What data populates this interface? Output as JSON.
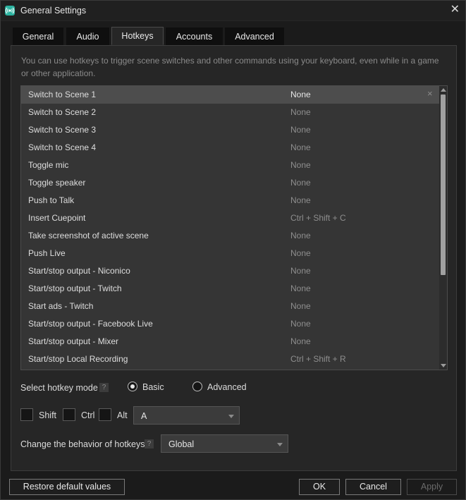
{
  "window": {
    "title": "General Settings"
  },
  "tabs": [
    {
      "label": "General"
    },
    {
      "label": "Audio"
    },
    {
      "label": "Hotkeys"
    },
    {
      "label": "Accounts"
    },
    {
      "label": "Advanced"
    }
  ],
  "active_tab": "Hotkeys",
  "description": "You can use hotkeys to trigger scene switches and other commands using your keyboard, even while in a game or other application.",
  "hotkeys": [
    {
      "command": "Switch to Scene 1",
      "key": "None"
    },
    {
      "command": "Switch to Scene 2",
      "key": "None"
    },
    {
      "command": "Switch to Scene 3",
      "key": "None"
    },
    {
      "command": "Switch to Scene 4",
      "key": "None"
    },
    {
      "command": "Toggle mic",
      "key": "None"
    },
    {
      "command": "Toggle speaker",
      "key": "None"
    },
    {
      "command": "Push to Talk",
      "key": "None"
    },
    {
      "command": "Insert Cuepoint",
      "key": "Ctrl + Shift + C"
    },
    {
      "command": "Take screenshot of active scene",
      "key": "None"
    },
    {
      "command": "Push Live",
      "key": "None"
    },
    {
      "command": "Start/stop output - Niconico",
      "key": "None"
    },
    {
      "command": "Start/stop output - Twitch",
      "key": "None"
    },
    {
      "command": "Start ads - Twitch",
      "key": "None"
    },
    {
      "command": "Start/stop output - Facebook Live",
      "key": "None"
    },
    {
      "command": "Start/stop output - Mixer",
      "key": "None"
    },
    {
      "command": "Start/stop Local Recording",
      "key": "Ctrl + Shift + R"
    }
  ],
  "selected_row": 0,
  "row_clear_glyph": "×",
  "hotkey_mode": {
    "label": "Select hotkey mode",
    "help": "?",
    "options": [
      "Basic",
      "Advanced"
    ],
    "selected": "Basic"
  },
  "modifiers": {
    "shift": {
      "label": "Shift",
      "checked": false
    },
    "ctrl": {
      "label": "Ctrl",
      "checked": false
    },
    "alt": {
      "label": "Alt",
      "checked": false
    },
    "key_value": "A"
  },
  "behavior": {
    "label": "Change the behavior of hotkeys",
    "help": "?",
    "value": "Global"
  },
  "buttons": {
    "restore": "Restore default values",
    "ok": "OK",
    "cancel": "Cancel",
    "apply": "Apply"
  },
  "colors": {
    "app_icon": "#2bb3a0",
    "selected_row": "#4d4d4d",
    "list_bg": "#353535"
  }
}
